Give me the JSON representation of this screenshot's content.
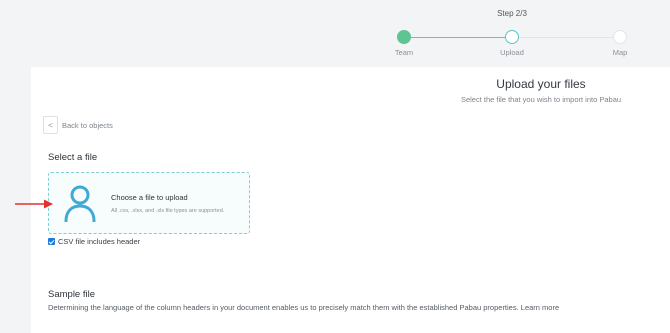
{
  "stepper": {
    "count": "Step 2/3",
    "steps": [
      {
        "label": "Team",
        "state": "done"
      },
      {
        "label": "Upload",
        "state": "current"
      },
      {
        "label": "Map",
        "state": "todo"
      }
    ]
  },
  "header": {
    "title": "Upload your files",
    "subtitle": "Select the file that you wish to import into Pabau"
  },
  "nav": {
    "back_label": "Back to objects",
    "back_icon": "<"
  },
  "select_file": {
    "title": "Select a file",
    "dropzone_title": "Choose a file to upload",
    "dropzone_hint": "All .csv, .xlsx, and .xls file types are supported.",
    "checkbox_label": "CSV file includes header",
    "checkbox_checked": true
  },
  "sample_file": {
    "title": "Sample file",
    "description": "Determining the language of the column headers in your document enables us to precisely match them with the established Pabau properties. Learn more"
  },
  "colors": {
    "accent": "#5ec4c8",
    "done": "#5cc591",
    "checkbox": "#1e7be0",
    "arrow": "#e5312b"
  }
}
